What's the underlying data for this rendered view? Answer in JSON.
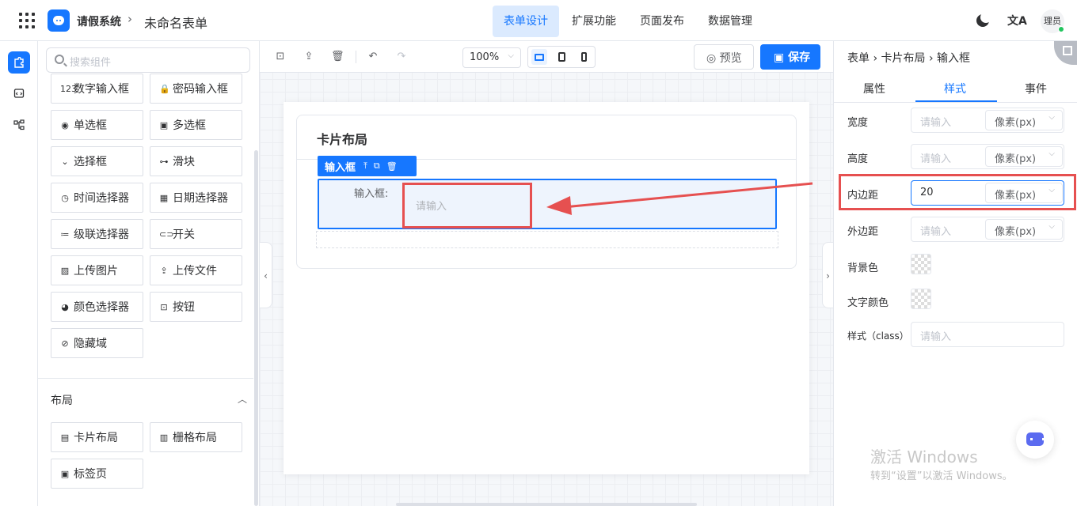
{
  "header": {
    "app_title": "请假系统",
    "breadcrumb_sep": "›",
    "form_name": "未命名表单",
    "tabs": [
      {
        "label": "表单设计",
        "active": true
      },
      {
        "label": "扩展功能",
        "active": false
      },
      {
        "label": "页面发布",
        "active": false
      },
      {
        "label": "数据管理",
        "active": false
      }
    ],
    "lang_icon": "文A",
    "avatar": "理员",
    "accent_color": "#1677ff"
  },
  "components": {
    "search_placeholder": "搜索组件",
    "items": [
      {
        "label": "数字输入框",
        "icon": "123"
      },
      {
        "label": "密码输入框",
        "icon": "🔒"
      },
      {
        "label": "单选框",
        "icon": "◉"
      },
      {
        "label": "多选框",
        "icon": "▣"
      },
      {
        "label": "选择框",
        "icon": "⌄"
      },
      {
        "label": "滑块",
        "icon": "⊶"
      },
      {
        "label": "时间选择器",
        "icon": "◷"
      },
      {
        "label": "日期选择器",
        "icon": "▦"
      },
      {
        "label": "级联选择器",
        "icon": "≔"
      },
      {
        "label": "开关",
        "icon": "⊂⊃"
      },
      {
        "label": "上传图片",
        "icon": "▨"
      },
      {
        "label": "上传文件",
        "icon": "⇪"
      },
      {
        "label": "颜色选择器",
        "icon": "◕"
      },
      {
        "label": "按钮",
        "icon": "⊡"
      },
      {
        "label": "隐藏域",
        "icon": "⊘"
      }
    ],
    "layout_title": "布局",
    "layout_items": [
      {
        "label": "卡片布局",
        "icon": "▤"
      },
      {
        "label": "栅格布局",
        "icon": "▥"
      },
      {
        "label": "标签页",
        "icon": "▣"
      }
    ]
  },
  "toolbar": {
    "zoom": "100%",
    "preview_label": "预览",
    "save_label": "保存"
  },
  "canvas": {
    "card_title": "卡片布局",
    "selected_toolbar_label": "输入框",
    "field_label": "输入框:",
    "field_placeholder": "请输入",
    "highlight_color": "#e65050"
  },
  "properties": {
    "breadcrumb": "表单 › 卡片布局 › 输入框",
    "tabs": [
      {
        "label": "属性",
        "active": false
      },
      {
        "label": "样式",
        "active": true
      },
      {
        "label": "事件",
        "active": false
      }
    ],
    "rows": [
      {
        "label": "宽度",
        "value": "",
        "placeholder": "请输入",
        "unit": "像素(px)"
      },
      {
        "label": "高度",
        "value": "",
        "placeholder": "请输入",
        "unit": "像素(px)"
      },
      {
        "label": "内边距",
        "value": "20",
        "placeholder": "请输入",
        "unit": "像素(px)"
      },
      {
        "label": "外边距",
        "value": "",
        "placeholder": "请输入",
        "unit": "像素(px)"
      }
    ],
    "bg_color_label": "背景色",
    "text_color_label": "文字颜色",
    "class_label": "样式（class）",
    "class_placeholder": "请输入"
  },
  "watermark": {
    "line1": "激活 Windows",
    "line2": "转到“设置”以激活 Windows。"
  }
}
